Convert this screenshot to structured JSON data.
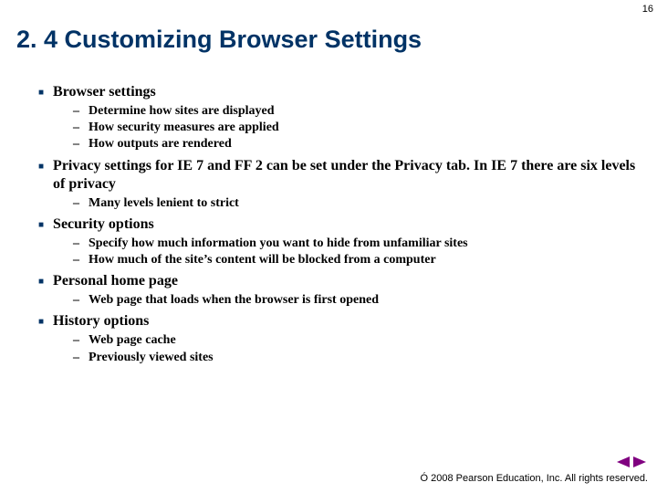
{
  "page_number": "16",
  "title": "2. 4 Customizing Browser Settings",
  "items": [
    {
      "text": "Browser settings",
      "sub": [
        "Determine how sites are displayed",
        "How security measures are applied",
        "How outputs are rendered"
      ]
    },
    {
      "text": "Privacy settings for IE 7 and FF 2 can be set under the Privacy tab. In IE 7 there are six levels of privacy",
      "sub": [
        "Many levels lenient to strict"
      ]
    },
    {
      "text": "Security options",
      "sub": [
        "Specify how much information you want to hide from unfamiliar sites",
        "How much of the site’s content will be blocked from a computer"
      ]
    },
    {
      "text": "Personal home page",
      "sub": [
        "Web page that loads when the browser is first opened"
      ]
    },
    {
      "text": "History options",
      "sub": [
        "Web page cache",
        "Previously viewed sites"
      ]
    }
  ],
  "footer": {
    "copyright_symbol": "Ó",
    "text": " 2008 Pearson Education, Inc.  All rights reserved."
  }
}
